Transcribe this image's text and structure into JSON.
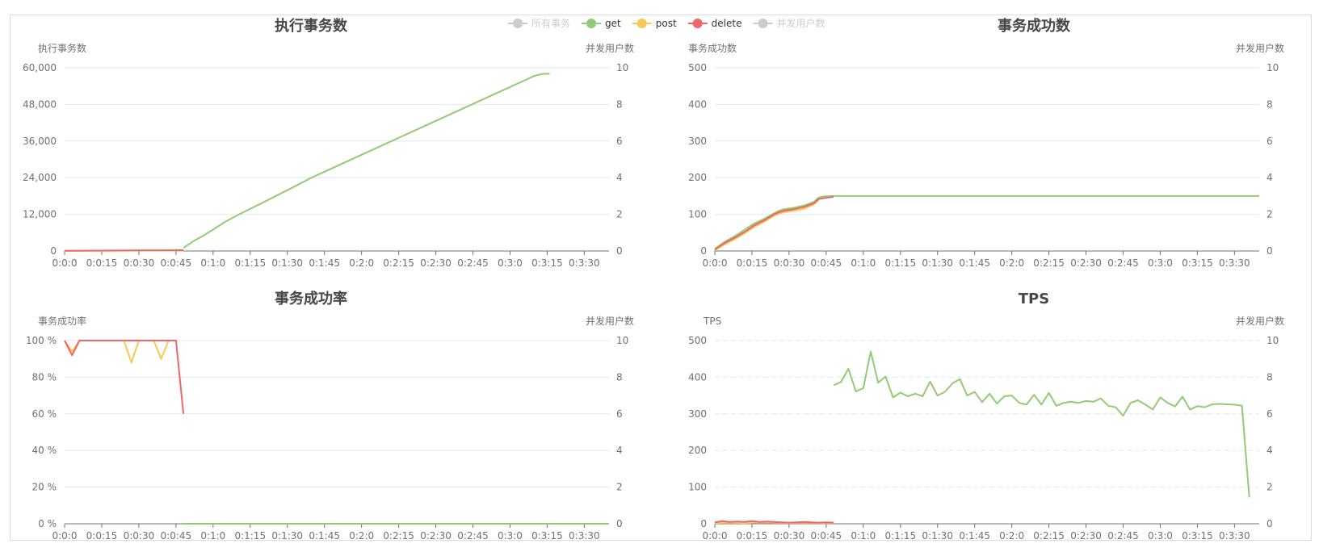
{
  "legend": {
    "items": [
      {
        "label": "所有事务",
        "color": "#cccccc",
        "active": false
      },
      {
        "label": "get",
        "color": "#91cc75",
        "active": true
      },
      {
        "label": "post",
        "color": "#fac858",
        "active": true
      },
      {
        "label": "delete",
        "color": "#ee6666",
        "active": true
      },
      {
        "label": "并发用户数",
        "color": "#cccccc",
        "active": false
      }
    ]
  },
  "x_ticks": [
    "0:0:0",
    "0:0:15",
    "0:0:30",
    "0:0:45",
    "0:1:0",
    "0:1:15",
    "0:1:30",
    "0:1:45",
    "0:2:0",
    "0:2:15",
    "0:2:30",
    "0:2:45",
    "0:3:0",
    "0:3:15",
    "0:3:30"
  ],
  "colors": {
    "get": "#91cc75",
    "post": "#fac858",
    "delete": "#ee6666",
    "axis": "#6e7079",
    "grid": "#e0e6f1"
  },
  "chart_data": [
    {
      "type": "line",
      "title": "执行事务数",
      "ylabel": "执行事务数",
      "y2label": "并发用户数",
      "ylim": [
        0,
        60000
      ],
      "yticks": [
        "0",
        "12,000",
        "24,000",
        "36,000",
        "48,000",
        "60,000"
      ],
      "y2ticks": [
        "0",
        "2",
        "4",
        "6",
        "8",
        "10"
      ],
      "xlim": [
        0,
        220
      ],
      "grid_dashed": false,
      "series": [
        {
          "name": "get",
          "color": "#91cc75",
          "points": [
            [
              48,
              1000
            ],
            [
              52,
              3200
            ],
            [
              56,
              5000
            ],
            [
              60,
              7000
            ],
            [
              65,
              9600
            ],
            [
              70,
              11800
            ],
            [
              80,
              15800
            ],
            [
              90,
              19900
            ],
            [
              100,
              24100
            ],
            [
              110,
              27800
            ],
            [
              120,
              31500
            ],
            [
              130,
              35200
            ],
            [
              140,
              38900
            ],
            [
              150,
              42600
            ],
            [
              160,
              46300
            ],
            [
              170,
              50000
            ],
            [
              180,
              53700
            ],
            [
              190,
              57400
            ],
            [
              193,
              58000
            ],
            [
              196,
              58100
            ]
          ]
        },
        {
          "name": "post",
          "color": "#fac858",
          "points": [
            [
              0,
              30
            ],
            [
              10,
              60
            ],
            [
              20,
              90
            ],
            [
              30,
              120
            ],
            [
              40,
              140
            ],
            [
              48,
              150
            ]
          ]
        },
        {
          "name": "delete",
          "color": "#ee6666",
          "points": [
            [
              0,
              60
            ],
            [
              10,
              110
            ],
            [
              20,
              160
            ],
            [
              30,
              210
            ],
            [
              40,
              250
            ],
            [
              48,
              270
            ]
          ]
        }
      ]
    },
    {
      "type": "line",
      "title": "事务成功数",
      "ylabel": "事务成功数",
      "y2label": "并发用户数",
      "ylim": [
        0,
        500
      ],
      "yticks": [
        "0",
        "100",
        "200",
        "300",
        "400",
        "500"
      ],
      "y2ticks": [
        "0",
        "2",
        "4",
        "6",
        "8",
        "10"
      ],
      "xlim": [
        0,
        220
      ],
      "grid_dashed": false,
      "series": [
        {
          "name": "get",
          "color": "#91cc75",
          "points": [
            [
              0,
              6
            ],
            [
              4,
              25
            ],
            [
              8,
              40
            ],
            [
              12,
              58
            ],
            [
              16,
              75
            ],
            [
              20,
              88
            ],
            [
              24,
              103
            ],
            [
              26,
              110
            ],
            [
              28,
              114
            ],
            [
              32,
              118
            ],
            [
              36,
              124
            ],
            [
              40,
              134
            ],
            [
              42,
              146
            ],
            [
              44,
              149
            ],
            [
              48,
              150
            ],
            [
              220,
              150
            ]
          ]
        },
        {
          "name": "post",
          "color": "#fac858",
          "points": [
            [
              0,
              2
            ],
            [
              4,
              18
            ],
            [
              8,
              32
            ],
            [
              12,
              48
            ],
            [
              16,
              66
            ],
            [
              20,
              80
            ],
            [
              24,
              96
            ],
            [
              26,
              102
            ],
            [
              28,
              106
            ],
            [
              32,
              110
            ],
            [
              36,
              115
            ],
            [
              40,
              127
            ],
            [
              42,
              140
            ]
          ]
        },
        {
          "name": "delete",
          "color": "#ee6666",
          "points": [
            [
              0,
              4
            ],
            [
              4,
              22
            ],
            [
              8,
              36
            ],
            [
              12,
              52
            ],
            [
              16,
              70
            ],
            [
              20,
              84
            ],
            [
              24,
              100
            ],
            [
              26,
              106
            ],
            [
              28,
              110
            ],
            [
              32,
              114
            ],
            [
              36,
              120
            ],
            [
              40,
              130
            ],
            [
              42,
              142
            ],
            [
              48,
              148
            ]
          ]
        }
      ]
    },
    {
      "type": "line",
      "title": "事务成功率",
      "ylabel": "事务成功率",
      "y2label": "并发用户数",
      "ylim": [
        0,
        100
      ],
      "yticks": [
        "0 %",
        "20 %",
        "40 %",
        "60 %",
        "80 %",
        "100 %"
      ],
      "y2ticks": [
        "0",
        "2",
        "4",
        "6",
        "8",
        "10"
      ],
      "xlim": [
        0,
        220
      ],
      "grid_dashed": false,
      "series": [
        {
          "name": "get",
          "color": "#91cc75",
          "points": [
            [
              48,
              0
            ],
            [
              220,
              0
            ]
          ]
        },
        {
          "name": "post",
          "color": "#fac858",
          "points": [
            [
              0,
              100
            ],
            [
              3,
              94
            ],
            [
              6,
              100
            ],
            [
              24,
              100
            ],
            [
              27,
              88
            ],
            [
              30,
              100
            ],
            [
              36,
              100
            ],
            [
              39,
              90
            ],
            [
              42,
              100
            ],
            [
              45,
              100
            ]
          ]
        },
        {
          "name": "delete",
          "color": "#ee6666",
          "points": [
            [
              0,
              100
            ],
            [
              3,
              92
            ],
            [
              6,
              100
            ],
            [
              45,
              100
            ],
            [
              48,
              60
            ]
          ]
        }
      ]
    },
    {
      "type": "line",
      "title": "TPS",
      "ylabel": "TPS",
      "y2label": "并发用户数",
      "ylim": [
        0,
        500
      ],
      "yticks": [
        "0",
        "100",
        "200",
        "300",
        "400",
        "500"
      ],
      "y2ticks": [
        "0",
        "2",
        "4",
        "6",
        "8",
        "10"
      ],
      "xlim": [
        0,
        220
      ],
      "grid_dashed": true,
      "series": [
        {
          "name": "get",
          "color": "#91cc75",
          "points": [
            [
              48,
              378
            ],
            [
              51,
              387
            ],
            [
              54,
              423
            ],
            [
              57,
              361
            ],
            [
              60,
              370
            ],
            [
              63,
              470
            ],
            [
              66,
              385
            ],
            [
              69,
              402
            ],
            [
              72,
              345
            ],
            [
              75,
              358
            ],
            [
              78,
              348
            ],
            [
              81,
              355
            ],
            [
              84,
              348
            ],
            [
              87,
              388
            ],
            [
              90,
              350
            ],
            [
              93,
              360
            ],
            [
              96,
              383
            ],
            [
              99,
              395
            ],
            [
              102,
              350
            ],
            [
              105,
              360
            ],
            [
              108,
              332
            ],
            [
              111,
              355
            ],
            [
              114,
              328
            ],
            [
              117,
              348
            ],
            [
              120,
              350
            ],
            [
              123,
              330
            ],
            [
              126,
              325
            ],
            [
              129,
              352
            ],
            [
              132,
              325
            ],
            [
              135,
              357
            ],
            [
              138,
              322
            ],
            [
              141,
              330
            ],
            [
              144,
              333
            ],
            [
              147,
              330
            ],
            [
              150,
              335
            ],
            [
              153,
              333
            ],
            [
              156,
              342
            ],
            [
              159,
              322
            ],
            [
              162,
              318
            ],
            [
              165,
              295
            ],
            [
              168,
              330
            ],
            [
              171,
              337
            ],
            [
              174,
              325
            ],
            [
              177,
              312
            ],
            [
              180,
              345
            ],
            [
              183,
              330
            ],
            [
              186,
              320
            ],
            [
              189,
              347
            ],
            [
              192,
              312
            ],
            [
              195,
              321
            ],
            [
              198,
              318
            ],
            [
              201,
              326
            ],
            [
              204,
              327
            ],
            [
              207,
              326
            ],
            [
              210,
              325
            ],
            [
              213,
              322
            ],
            [
              216,
              72
            ]
          ]
        },
        {
          "name": "post",
          "color": "#fac858",
          "points": [
            [
              0,
              2
            ],
            [
              6,
              3
            ],
            [
              12,
              2
            ],
            [
              18,
              4
            ],
            [
              24,
              3
            ],
            [
              30,
              2
            ],
            [
              36,
              3
            ],
            [
              42,
              2
            ],
            [
              48,
              2
            ]
          ]
        },
        {
          "name": "delete",
          "color": "#ee6666",
          "points": [
            [
              0,
              4
            ],
            [
              3,
              7
            ],
            [
              6,
              5
            ],
            [
              9,
              6
            ],
            [
              12,
              5
            ],
            [
              15,
              7
            ],
            [
              18,
              5
            ],
            [
              21,
              6
            ],
            [
              24,
              5
            ],
            [
              27,
              4
            ],
            [
              30,
              3
            ],
            [
              33,
              4
            ],
            [
              36,
              5
            ],
            [
              39,
              4
            ],
            [
              42,
              3
            ],
            [
              45,
              4
            ],
            [
              48,
              3
            ]
          ]
        }
      ]
    }
  ]
}
